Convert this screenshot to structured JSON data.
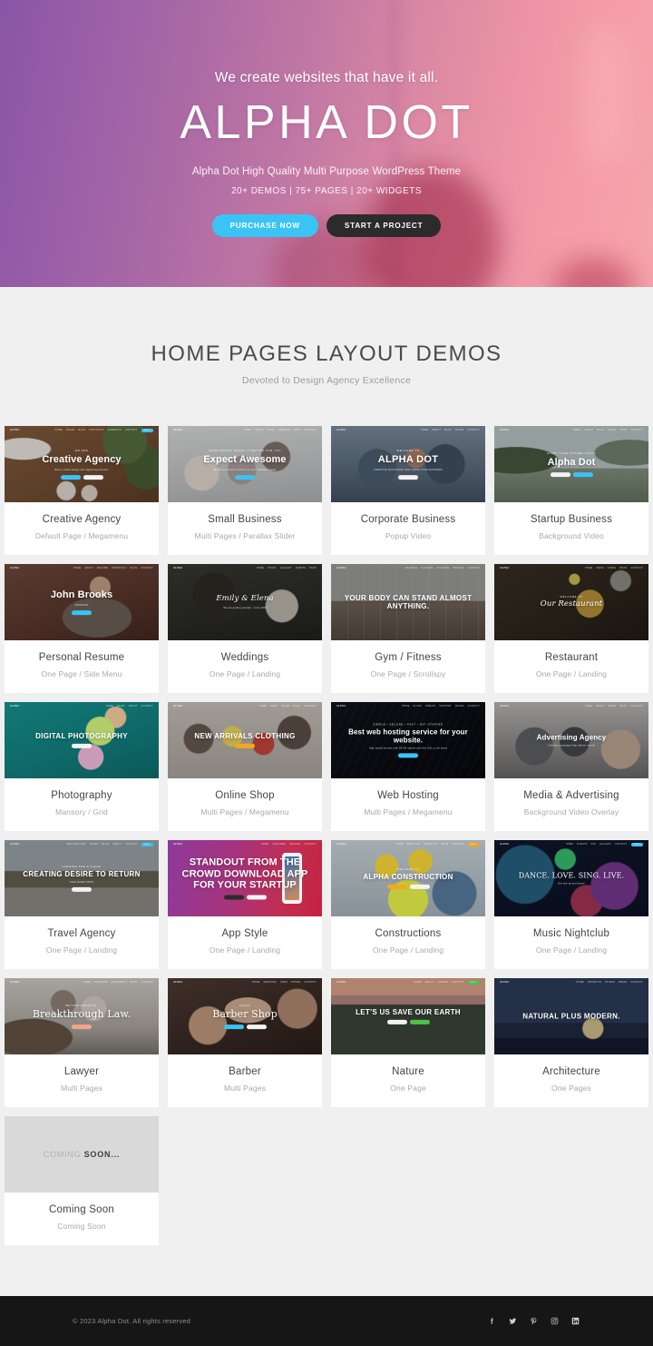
{
  "hero": {
    "eyebrow": "We create websites that have it all.",
    "title": "ALPHA DOT",
    "subtitle": "Alpha Dot High Quality Multi Purpose WordPress Theme",
    "stats": "20+ DEMOS | 75+ PAGES | 20+ WIDGETS",
    "buttons": {
      "primary": "PURCHASE NOW",
      "secondary": "START A PROJECT"
    },
    "colors": {
      "gradient_start": "#8a55a6",
      "gradient_end": "#f7a4ac",
      "primary_button": "#3ac4f5",
      "secondary_button": "#2b2b2b"
    }
  },
  "section": {
    "title": "HOME PAGES LAYOUT DEMOS",
    "subtitle": "Devoted to Design Agency Excellence"
  },
  "demos": [
    {
      "title": "Creative Agency",
      "meta": "Default Page / Megamenu",
      "brand": "ALPHA",
      "nav": [
        "HOME",
        "PAGES",
        "BLOG",
        "PORTFOLIO",
        "ELEMENTS",
        "CONTACT"
      ],
      "pre": "We are",
      "headline": "Creative Agency",
      "desc": "Best in class design and digital experiences",
      "btn1": "DISCOVER",
      "btn2": "ABOUT",
      "style": "creative"
    },
    {
      "title": "Small Business",
      "meta": "Multi Pages / Parallax Slider",
      "brand": "ALPHA",
      "nav": [
        "HOME",
        "ABOUT",
        "BLOG",
        "SERVICE",
        "SHOP",
        "CONTACT"
      ],
      "pre": "Good design makes it better for you",
      "headline": "Expect Awesome",
      "desc": "We bring creative solutions to your business needs",
      "btn1": "LEARN MORE",
      "btn2": "",
      "style": "smallbiz"
    },
    {
      "title": "Corporate Business",
      "meta": "Popup Video",
      "brand": "ALPHA",
      "nav": [
        "HOME",
        "ABOUT",
        "BLOG",
        "PAGES",
        "CONTACT"
      ],
      "pre": "WELCOME TO",
      "headline": "ALPHA DOT",
      "desc": "CREATIVE SOLUTIONS THAT GROW YOUR BUSINESS",
      "btn1": "READ MORE",
      "btn2": "",
      "style": "corporate"
    },
    {
      "title": "Startup Business",
      "meta": "Background Video",
      "brand": "ALPHA",
      "nav": [
        "HOME",
        "ABOUT",
        "BLOG",
        "PAGES",
        "SHOP",
        "CONTACT"
      ],
      "pre": "START YOUR FUTURE TODAY",
      "headline": "Alpha Dot",
      "desc": "",
      "btn1": "OUR WORK",
      "btn2": "CONTACT",
      "style": "startup"
    },
    {
      "title": "Personal Resume",
      "meta": "One Page / Side Menu",
      "brand": "ALPHA",
      "nav": [
        "HOME",
        "ABOUT",
        "RESUME",
        "PORTFOLIO",
        "BLOG",
        "CONTACT"
      ],
      "pre": "",
      "headline": "John Brooks",
      "desc": "ANIMATOR",
      "btn1": "HIRE ME",
      "btn2": "",
      "style": "resume"
    },
    {
      "title": "Weddings",
      "meta": "One Page / Landing",
      "brand": "ALPHA",
      "nav": [
        "HOME",
        "STORY",
        "GALLERY",
        "EVENTS",
        "RSVP"
      ],
      "pre": "",
      "headline": "Emily & Elena",
      "desc": "We are getting married  -  June 2023",
      "btn1": "",
      "btn2": "",
      "style": "wedding"
    },
    {
      "title": "Gym / Fitness",
      "meta": "One Page / Scrollspy",
      "brand": "ALPHA",
      "nav": [
        "TRAINING",
        "CLASSES",
        "COACHES",
        "PRICING",
        "CONTACT"
      ],
      "pre": "",
      "headline": "YOUR BODY CAN STAND ALMOST ANYTHING.",
      "desc": "",
      "btn1": "",
      "btn2": "",
      "style": "gym"
    },
    {
      "title": "Restaurant",
      "meta": "One Page / Landing",
      "brand": "ALPHA",
      "nav": [
        "HOME",
        "MENU",
        "CHEFS",
        "BOOK",
        "CONTACT"
      ],
      "pre": "WELCOME TO",
      "headline": "Our Restaurant",
      "desc": "",
      "btn1": "",
      "btn2": "",
      "style": "restaurant"
    },
    {
      "title": "Photography",
      "meta": "Mansory / Grid",
      "brand": "ALPHA",
      "nav": [
        "HOME",
        "WORK",
        "ABOUT",
        "CONTACT"
      ],
      "pre": "",
      "headline": "DIGITAL PHOTOGRAPHY",
      "desc": "",
      "btn1": "EXPLORE",
      "btn2": "",
      "style": "photo"
    },
    {
      "title": "Online Shop",
      "meta": "Multi Pages / Megamenu",
      "brand": "ALPHA",
      "nav": [
        "HOME",
        "SHOP",
        "PAGES",
        "BLOG",
        "CONTACT"
      ],
      "pre": "",
      "headline": "NEW ARRIVALS CLOTHING",
      "desc": "",
      "btn1": "SHOP NOW",
      "btn2": "",
      "style": "shop"
    },
    {
      "title": "Web Hosting",
      "meta": "Multi Pages / Megamenu",
      "brand": "ALPHA",
      "nav": [
        "HOME",
        "PLANS",
        "DOMAIN",
        "SUPPORT",
        "PAGES",
        "CONTACT"
      ],
      "pre": "Simple  •  Secure  •  Fast  •  Get Started",
      "headline": "Best web hosting service for your website.",
      "desc": "High speed servers with 99.9% uptime and free SSL on all plans",
      "btn1": "GET STARTED",
      "btn2": "",
      "style": "hosting"
    },
    {
      "title": "Media & Advertising",
      "meta": "Background Video Overlay",
      "brand": "ALPHA",
      "nav": [
        "HOME",
        "ABOUT",
        "WORK",
        "BLOG",
        "CONTACT"
      ],
      "pre": "",
      "headline": "Advertising Agency",
      "desc": "Creative campaigns that deliver results",
      "btn1": "",
      "btn2": "",
      "style": "media"
    },
    {
      "title": "Travel Agency",
      "meta": "One Page / Landing",
      "brand": "ALPHA",
      "nav": [
        "DESTINATIONS",
        "TOURS",
        "BLOG",
        "ABOUT",
        "CONTACT"
      ],
      "pre": "LONGING FOR A PLACE",
      "headline": "CREATING DESIRE TO RETURN",
      "desc": "TAKE MORE TRIPS",
      "btn1": "BOOK NOW",
      "btn2": "",
      "style": "travel"
    },
    {
      "title": "App Style",
      "meta": "One Page / Landing",
      "brand": "ALPHA",
      "nav": [
        "HOME",
        "FEATURES",
        "PRICING",
        "CONTACT"
      ],
      "pre": "",
      "headline": "STANDOUT FROM THE CROWD DOWNLOAD APP FOR YOUR STARTUP",
      "desc": "",
      "btn1": "APP STORE",
      "btn2": "GOOGLE PLAY",
      "style": "app"
    },
    {
      "title": "Constructions",
      "meta": "One Page / Landing",
      "brand": "ALPHA",
      "nav": [
        "HOME",
        "SERVICES",
        "PROJECTS",
        "TEAM",
        "CONTACT"
      ],
      "pre": "WELCOME TO",
      "headline": "ALPHA CONSTRUCTION",
      "desc": "",
      "btn1": "GET QUOTE",
      "btn2": "SERVICES",
      "style": "construction"
    },
    {
      "title": "Music Nightclub",
      "meta": "One Page / Landing",
      "brand": "ALPHA",
      "nav": [
        "HOME",
        "EVENTS",
        "DJS",
        "GALLERY",
        "CONTACT"
      ],
      "pre": "",
      "headline": "DANCE. LOVE. SING. LIVE.",
      "desc": "Get one up and dance",
      "btn1": "",
      "btn2": "",
      "style": "club"
    },
    {
      "title": "Lawyer",
      "meta": "Multi Pages",
      "brand": "ALPHA",
      "nav": [
        "HOME",
        "PRACTICE",
        "ATTORNEYS",
        "BLOG",
        "CONTACT"
      ],
      "pre": "Beyond Results.",
      "headline": "Breakthrough Law.",
      "desc": "",
      "btn1": "CONSULT",
      "btn2": "",
      "style": "lawyer"
    },
    {
      "title": "Barber",
      "meta": "Multi Pages",
      "brand": "ALPHA",
      "nav": [
        "HOME",
        "SERVICES",
        "TEAM",
        "PRICES",
        "CONTACT"
      ],
      "pre": "Alpha",
      "headline": "Barber Shop",
      "desc": "",
      "btn1": "BOOK NOW",
      "btn2": "PRICES",
      "style": "barber"
    },
    {
      "title": "Nature",
      "meta": "One Page",
      "brand": "ALPHA",
      "nav": [
        "HOME",
        "ABOUT",
        "CAUSES",
        "CONTACT"
      ],
      "pre": "",
      "headline": "LET'S US SAVE OUR EARTH",
      "desc": "",
      "btn1": "DONATE",
      "btn2": "JOIN US",
      "style": "nature"
    },
    {
      "title": "Architecture",
      "meta": "One Pages",
      "brand": "ALPHA",
      "nav": [
        "HOME",
        "PROJECTS",
        "STUDIO",
        "PRESS",
        "CONTACT"
      ],
      "pre": "",
      "headline": "NATURAL PLUS MODERN.",
      "desc": "",
      "btn1": "",
      "btn2": "",
      "style": "architecture"
    },
    {
      "title": "Coming Soon",
      "meta": "Coming Soon",
      "brand": "",
      "nav": [],
      "pre": "COMING",
      "headline": "SOON...",
      "desc": "",
      "btn1": "",
      "btn2": "",
      "style": "soon"
    }
  ],
  "footer": {
    "copyright": "© 2023 Alpha Dot. All rights reserved",
    "socials": [
      {
        "name": "facebook",
        "label": "Facebook"
      },
      {
        "name": "twitter",
        "label": "Twitter"
      },
      {
        "name": "pinterest",
        "label": "Pinterest"
      },
      {
        "name": "instagram",
        "label": "Instagram"
      },
      {
        "name": "linkedin",
        "label": "LinkedIn"
      }
    ]
  }
}
